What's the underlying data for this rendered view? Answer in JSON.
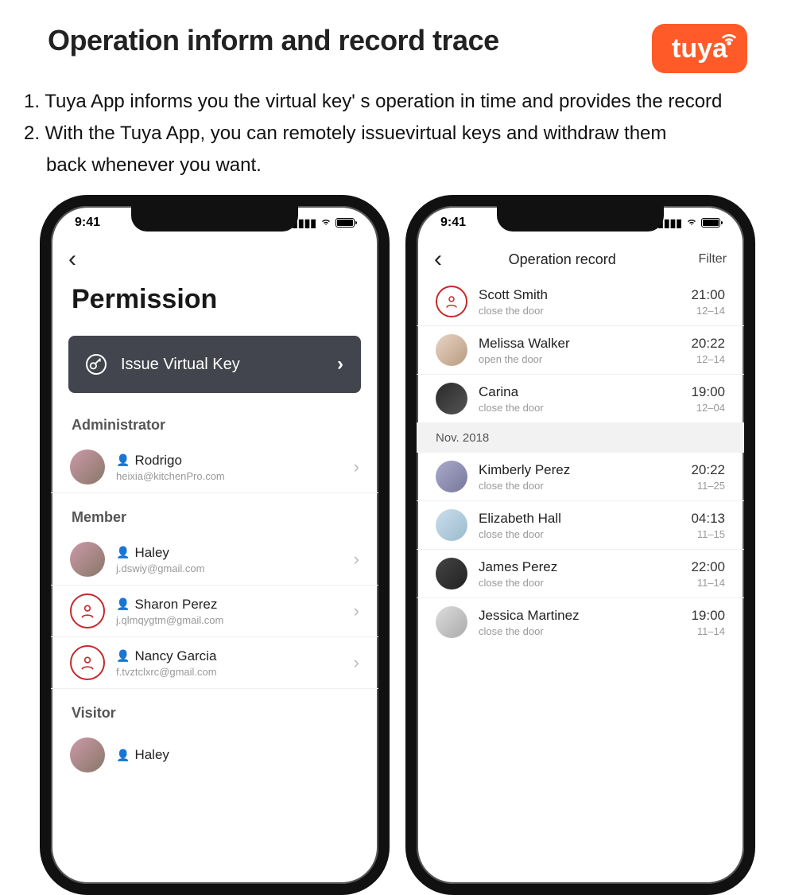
{
  "header": {
    "title": "Operation inform and record trace",
    "badge_text": "tuya"
  },
  "bullets": {
    "line1": "1. Tuya App informs you the virtual key' s operation in time and provides the record",
    "line2a": "2. With the Tuya App, you can remotely issuevirtual keys and withdraw them",
    "line2b": "back whenever you want."
  },
  "phone1": {
    "time": "9:41",
    "title": "Permission",
    "issue_label": "Issue Virtual Key",
    "sections": {
      "admin": "Administrator",
      "member": "Member",
      "visitor": "Visitor"
    },
    "admin": [
      {
        "name": "Rodrigo",
        "email": "heixia@kitchenPro.com"
      }
    ],
    "members": [
      {
        "name": "Haley",
        "email": "j.dswiy@gmail.com"
      },
      {
        "name": "Sharon Perez",
        "email": "j.qlmqygtm@gmail.com"
      },
      {
        "name": "Nancy Garcia",
        "email": "f.tvztclxrc@gmail.com"
      }
    ],
    "visitors": [
      {
        "name": "Haley"
      }
    ]
  },
  "phone2": {
    "time": "9:41",
    "nav_title": "Operation record",
    "filter": "Filter",
    "month_header": "Nov. 2018",
    "records_top": [
      {
        "name": "Scott Smith",
        "action": "close the door",
        "time": "21:00",
        "date": "12–14"
      },
      {
        "name": "Melissa Walker",
        "action": "open the door",
        "time": "20:22",
        "date": "12–14"
      },
      {
        "name": "Carina",
        "action": "close the door",
        "time": "19:00",
        "date": "12–04"
      }
    ],
    "records_nov": [
      {
        "name": "Kimberly Perez",
        "action": "close the door",
        "time": "20:22",
        "date": "11–25"
      },
      {
        "name": "Elizabeth Hall",
        "action": "close the door",
        "time": "04:13",
        "date": "11–15"
      },
      {
        "name": "James Perez",
        "action": "close the door",
        "time": "22:00",
        "date": "11–14"
      },
      {
        "name": "Jessica Martinez",
        "action": "close the door",
        "time": "19:00",
        "date": "11–14"
      }
    ]
  }
}
